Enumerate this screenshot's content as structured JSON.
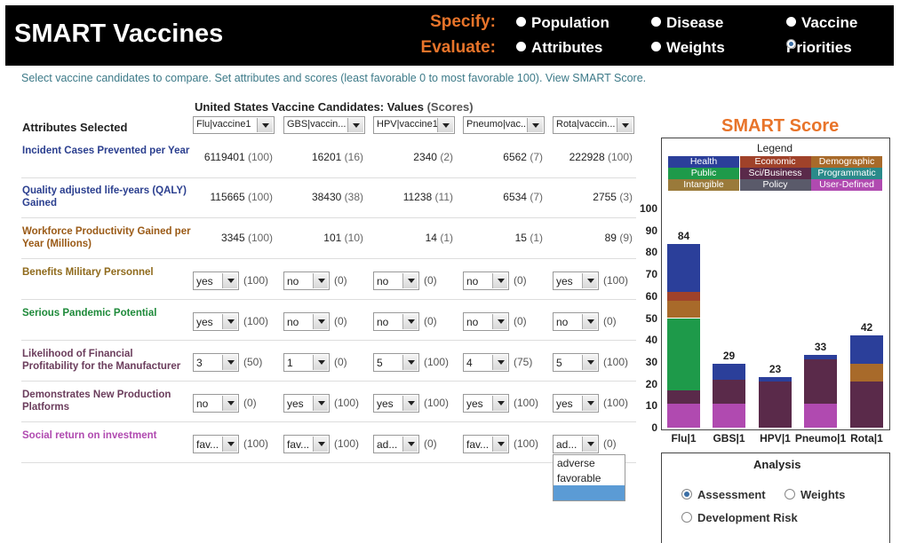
{
  "header": {
    "title": "SMART Vaccines",
    "specify_label": "Specify:",
    "evaluate_label": "Evaluate:",
    "specify_options": [
      "Population",
      "Disease",
      "Vaccine"
    ],
    "evaluate_options": [
      "Attributes",
      "Weights",
      "Priorities"
    ],
    "selected_evaluate": "Priorities"
  },
  "instructions": "Select vaccine candidates to compare. Set attributes and scores (least favorable 0 to most favorable 100). View SMART Score.",
  "table": {
    "title": "United States Vaccine Candidates: Values",
    "title_sub": "(Scores)",
    "attributes_header": "Attributes Selected",
    "candidates": [
      "Flu|vaccine1",
      "GBS|vaccin...",
      "HPV|vaccine1",
      "Pneumo|vac...",
      "Rota|vaccin..."
    ],
    "rows": [
      {
        "label": "Incident Cases Prevented per Year",
        "color": "#2b3f8f",
        "type": "value",
        "cells": [
          [
            "6119401",
            "(100)"
          ],
          [
            "16201",
            "(16)"
          ],
          [
            "2340",
            "(2)"
          ],
          [
            "6562",
            "(7)"
          ],
          [
            "222928",
            "(100)"
          ]
        ]
      },
      {
        "label": "Quality adjusted life-years (QALY) Gained",
        "color": "#2b3f8f",
        "type": "value",
        "cells": [
          [
            "115665",
            "(100)"
          ],
          [
            "38430",
            "(38)"
          ],
          [
            "11238",
            "(11)"
          ],
          [
            "6534",
            "(7)"
          ],
          [
            "2755",
            "(3)"
          ]
        ]
      },
      {
        "label": "Workforce Productivity Gained per Year (Millions)",
        "color": "#9a5a16",
        "type": "value",
        "cells": [
          [
            "3345",
            "(100)"
          ],
          [
            "101",
            "(10)"
          ],
          [
            "14",
            "(1)"
          ],
          [
            "15",
            "(1)"
          ],
          [
            "89",
            "(9)"
          ]
        ]
      },
      {
        "label": "Benefits Military Personnel",
        "color": "#8f6a1c",
        "type": "select",
        "cells": [
          [
            "yes",
            "(100)"
          ],
          [
            "no",
            "(0)"
          ],
          [
            "no",
            "(0)"
          ],
          [
            "no",
            "(0)"
          ],
          [
            "yes",
            "(100)"
          ]
        ]
      },
      {
        "label": "Serious Pandemic Potential",
        "color": "#1e8a3a",
        "type": "select",
        "cells": [
          [
            "yes",
            "(100)"
          ],
          [
            "no",
            "(0)"
          ],
          [
            "no",
            "(0)"
          ],
          [
            "no",
            "(0)"
          ],
          [
            "no",
            "(0)"
          ]
        ]
      },
      {
        "label": "Likelihood of Financial Profitability for the Manufacturer",
        "color": "#6b3d5c",
        "type": "select",
        "cells": [
          [
            "3",
            "(50)"
          ],
          [
            "1",
            "(0)"
          ],
          [
            "5",
            "(100)"
          ],
          [
            "4",
            "(75)"
          ],
          [
            "5",
            "(100)"
          ]
        ]
      },
      {
        "label": "Demonstrates New Production Platforms",
        "color": "#6b3d5c",
        "type": "select",
        "cells": [
          [
            "no",
            "(0)"
          ],
          [
            "yes",
            "(100)"
          ],
          [
            "yes",
            "(100)"
          ],
          [
            "yes",
            "(100)"
          ],
          [
            "yes",
            "(100)"
          ]
        ]
      },
      {
        "label": "Social return on investment",
        "color": "#b04ab0",
        "type": "select",
        "cells": [
          [
            "fav...",
            "(100)"
          ],
          [
            "fav...",
            "(100)"
          ],
          [
            "ad...",
            "(0)"
          ],
          [
            "fav...",
            "(100)"
          ],
          [
            "ad...",
            "(0)"
          ]
        ]
      }
    ],
    "open_dropdown_options": [
      "adverse",
      "favorable",
      ""
    ]
  },
  "chart": {
    "title": "SMART Score",
    "legend_title": "Legend",
    "legend": [
      {
        "name": "Health",
        "color": "#2b3f9a"
      },
      {
        "name": "Economic",
        "color": "#a0422a"
      },
      {
        "name": "Demographic",
        "color": "#a86a2a"
      },
      {
        "name": "Public",
        "color": "#1e9a4a"
      },
      {
        "name": "Sci/Business",
        "color": "#5a2a4a"
      },
      {
        "name": "Programmatic",
        "color": "#2a8a8a"
      },
      {
        "name": "Intangible",
        "color": "#9a7a3a"
      },
      {
        "name": "Policy",
        "color": "#5a5a6a"
      },
      {
        "name": "User-Defined",
        "color": "#b04ab0"
      }
    ]
  },
  "chart_data": {
    "type": "bar",
    "categories": [
      "Flu|1",
      "GBS|1",
      "HPV|1",
      "Pneumo|1",
      "Rota|1"
    ],
    "totals": [
      84,
      29,
      23,
      33,
      42
    ],
    "ylim": [
      0,
      100
    ],
    "yticks": [
      "0",
      "10",
      "20",
      "30",
      "40",
      "50",
      "60",
      "70",
      "80",
      "90",
      "100"
    ],
    "stacked_segments": [
      [
        {
          "s": "User-Defined",
          "v": 11
        },
        {
          "s": "Sci/Business",
          "v": 6
        },
        {
          "s": "Public",
          "v": 33
        },
        {
          "s": "Demographic",
          "v": 8
        },
        {
          "s": "Economic",
          "v": 4
        },
        {
          "s": "Health",
          "v": 22
        }
      ],
      [
        {
          "s": "User-Defined",
          "v": 11
        },
        {
          "s": "Sci/Business",
          "v": 11
        },
        {
          "s": "Health",
          "v": 7
        }
      ],
      [
        {
          "s": "Sci/Business",
          "v": 21
        },
        {
          "s": "Health",
          "v": 2
        }
      ],
      [
        {
          "s": "User-Defined",
          "v": 11
        },
        {
          "s": "Sci/Business",
          "v": 20
        },
        {
          "s": "Health",
          "v": 2
        }
      ],
      [
        {
          "s": "Sci/Business",
          "v": 21
        },
        {
          "s": "Demographic",
          "v": 8
        },
        {
          "s": "Health",
          "v": 13
        }
      ]
    ],
    "xlabel": "",
    "ylabel": ""
  },
  "analysis": {
    "title": "Analysis",
    "options": [
      "Assessment",
      "Weights",
      "Development Risk"
    ],
    "selected": "Assessment"
  }
}
